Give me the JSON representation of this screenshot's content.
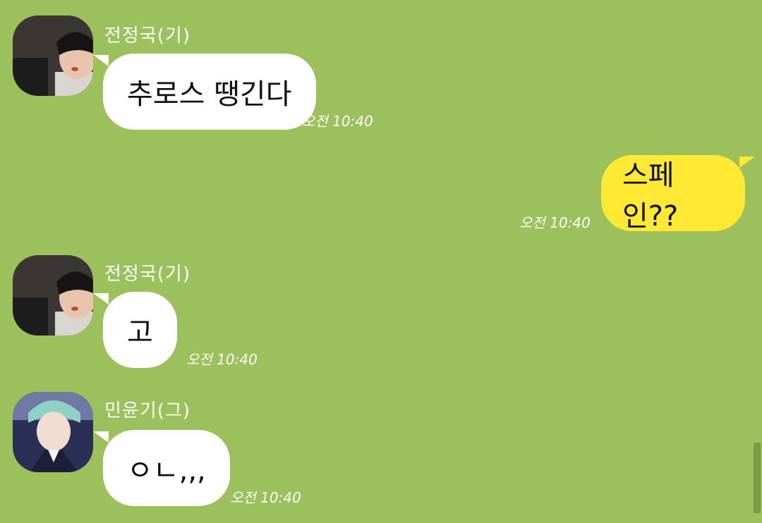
{
  "messages": [
    {
      "sender": "전정국(기)",
      "text": "추로스 땡긴다",
      "time": "오전 10:40",
      "direction": "incoming",
      "avatar": "jungkook-avatar"
    },
    {
      "sender": "",
      "text": "스페인??",
      "time": "오전 10:40",
      "direction": "outgoing"
    },
    {
      "sender": "전정국(기)",
      "text": "고",
      "time": "오전 10:40",
      "direction": "incoming",
      "avatar": "jungkook-avatar"
    },
    {
      "sender": "민윤기(그)",
      "text": "ㅇㄴ,,,",
      "time": "오전 10:40",
      "direction": "incoming",
      "avatar": "yoongi-avatar"
    }
  ],
  "colors": {
    "background": "#9bc05c",
    "incoming_bubble": "#ffffff",
    "outgoing_bubble": "#ffe934"
  }
}
